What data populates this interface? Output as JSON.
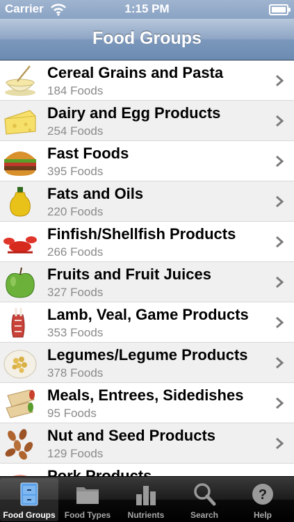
{
  "status": {
    "carrier": "Carrier",
    "time": "1:15 PM"
  },
  "nav": {
    "title": "Food Groups"
  },
  "groups": [
    {
      "name": "Cereal Grains and Pasta",
      "count": "184 Foods",
      "icon": "cereal-bowl-icon"
    },
    {
      "name": "Dairy and Egg Products",
      "count": "254 Foods",
      "icon": "cheese-icon"
    },
    {
      "name": "Fast Foods",
      "count": "395 Foods",
      "icon": "burger-icon"
    },
    {
      "name": "Fats and Oils",
      "count": "220 Foods",
      "icon": "oil-bottle-icon"
    },
    {
      "name": "Finfish/Shellfish Products",
      "count": "266 Foods",
      "icon": "lobster-icon"
    },
    {
      "name": "Fruits and Fruit Juices",
      "count": "327 Foods",
      "icon": "apple-icon"
    },
    {
      "name": "Lamb, Veal, Game Products",
      "count": "353 Foods",
      "icon": "lamb-rack-icon"
    },
    {
      "name": "Legumes/Legume Products",
      "count": "378 Foods",
      "icon": "chickpeas-icon"
    },
    {
      "name": "Meals, Entrees, Sidedishes",
      "count": "95 Foods",
      "icon": "wrap-icon"
    },
    {
      "name": "Nut and Seed Products",
      "count": "129 Foods",
      "icon": "almonds-icon"
    },
    {
      "name": "Pork Products",
      "count": "",
      "icon": "pork-icon"
    }
  ],
  "tabs": [
    {
      "label": "Food Groups",
      "icon": "cabinet-icon",
      "active": true
    },
    {
      "label": "Food Types",
      "icon": "folder-icon",
      "active": false
    },
    {
      "label": "Nutrients",
      "icon": "bar-chart-icon",
      "active": false
    },
    {
      "label": "Search",
      "icon": "magnifier-icon",
      "active": false
    },
    {
      "label": "Help",
      "icon": "help-icon",
      "active": false
    }
  ]
}
